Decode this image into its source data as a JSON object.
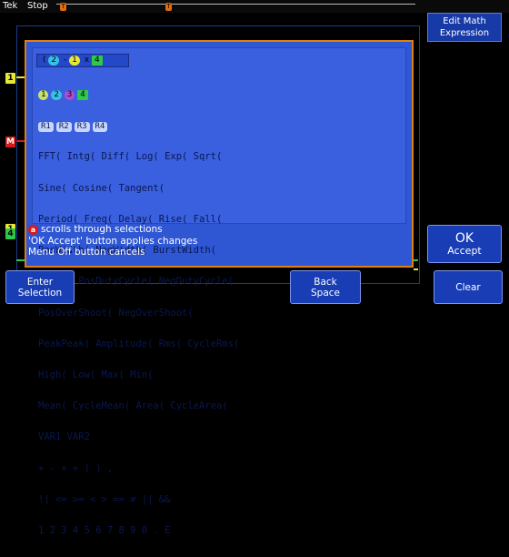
{
  "status": {
    "brand": "Tek",
    "state": "Stop"
  },
  "trigger_markers": [
    "T",
    "T"
  ],
  "channels": [
    {
      "label": "1",
      "color": "#e7e735"
    },
    {
      "label": "M",
      "color": "#d41a1a"
    },
    {
      "label": "1",
      "color": "#e7e735"
    },
    {
      "label": "4",
      "color": "#2ec84a"
    }
  ],
  "dialog": {
    "expression": {
      "chips": [
        "2",
        "-",
        "1",
        "x",
        "4"
      ]
    },
    "channel_chips": [
      "1",
      "2",
      "3",
      "4"
    ],
    "ref_chips": [
      "R1",
      "R2",
      "R3",
      "R4"
    ],
    "lines": [
      "FFT( Intg( Diff( Log( Exp( Sqrt(",
      "Sine( Cosine( Tangent(",
      "Period( Freq( Delay( Rise( Fall(",
      "PosWidth( NegWidth( BurstWidth(",
      "Phase( PosDutyCycle( NegDutyCycle(",
      "PosOverShoot( NegOverShoot(",
      "PeakPeak( Amplitude( Rms( CycleRms(",
      "High( Low( Max( Min(",
      "Mean( CycleMean( Area( CycleArea(",
      "VAR1 VAR2",
      "+ - × ÷ ( ) ,",
      "!( <= >= < > == ≠ || &&",
      "1 2 3 4 5 6 7 8 9 0 . E"
    ],
    "help": [
      "scrolls through selections",
      "'OK Accept' button applies changes",
      "Menu Off button cancels"
    ],
    "help_icon": "a"
  },
  "side_panel": {
    "title_line1": "Edit Math",
    "title_line2": "Expression",
    "ok_line1": "OK",
    "ok_line2": "Accept"
  },
  "bottom_buttons": {
    "enter_line1": "Enter",
    "enter_line2": "Selection",
    "back_line1": "Back",
    "back_line2": "Space",
    "clear": "Clear"
  },
  "colors": {
    "accent_orange": "#e07f10",
    "dialog_blue": "#2f56d3",
    "button_blue": "#183db5"
  }
}
